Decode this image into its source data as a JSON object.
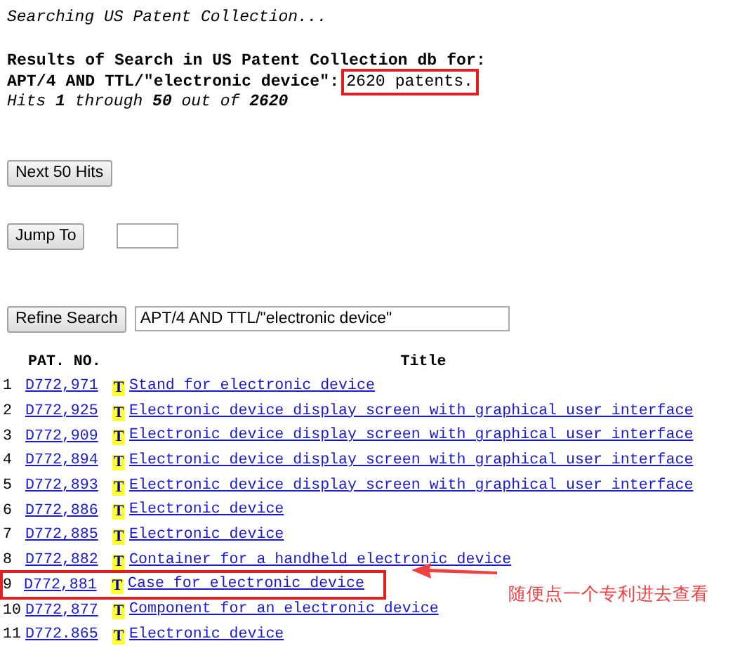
{
  "header": {
    "status": "Searching US Patent Collection...",
    "heading": "Results of Search in US Patent Collection db for:",
    "query": "APT/4 AND TTL/\"electronic device\":",
    "count": "2620 patents.",
    "count_highlighted": true,
    "hits": "Hits **1** through **50** out of **2620**"
  },
  "next_button": {
    "label": "Next 50 Hits"
  },
  "jump": {
    "label": "Jump To"
  },
  "refine": {
    "label": "Refine Search",
    "value": "APT/4 AND TTL/\"electronic device\""
  },
  "table": {
    "columns": [
      "PAT. NO.",
      "Title"
    ],
    "rows": [
      {
        "index": "1",
        "number": "D772,971",
        "icon": "T",
        "title": "Stand for electronic device",
        "highlighted": false
      },
      {
        "index": "2",
        "number": "D772,925",
        "icon": "T",
        "title": "Electronic device display screen with graphical user interface",
        "highlighted": false
      },
      {
        "index": "3",
        "number": "D772,909",
        "icon": "T",
        "title": "Electronic device display screen with graphical user interface",
        "highlighted": false
      },
      {
        "index": "4",
        "number": "D772,894",
        "icon": "T",
        "title": "Electronic device display screen with graphical user interface",
        "highlighted": false
      },
      {
        "index": "5",
        "number": "D772,893",
        "icon": "T",
        "title": "Electronic device display screen with graphical user interface",
        "highlighted": false
      },
      {
        "index": "6",
        "number": "D772,886",
        "icon": "T",
        "title": "Electronic device",
        "highlighted": false
      },
      {
        "index": "7",
        "number": "D772,885",
        "icon": "T",
        "title": "Electronic device",
        "highlighted": false
      },
      {
        "index": "8",
        "number": "D772,882",
        "icon": "T",
        "title": "Container for a handheld electronic device",
        "highlighted": false
      },
      {
        "index": "9",
        "number": "D772,881",
        "icon": "T",
        "title": "Case for electronic device",
        "highlighted": true
      },
      {
        "index": "10",
        "number": "D772,877",
        "icon": "T",
        "title": "Component for an electronic device",
        "highlighted": false
      },
      {
        "index": "11",
        "number": "D772.865",
        "icon": "T",
        "title": "Electronic device",
        "highlighted": false
      }
    ]
  },
  "annotation": {
    "text": "随便点一个专利进去查看"
  }
}
